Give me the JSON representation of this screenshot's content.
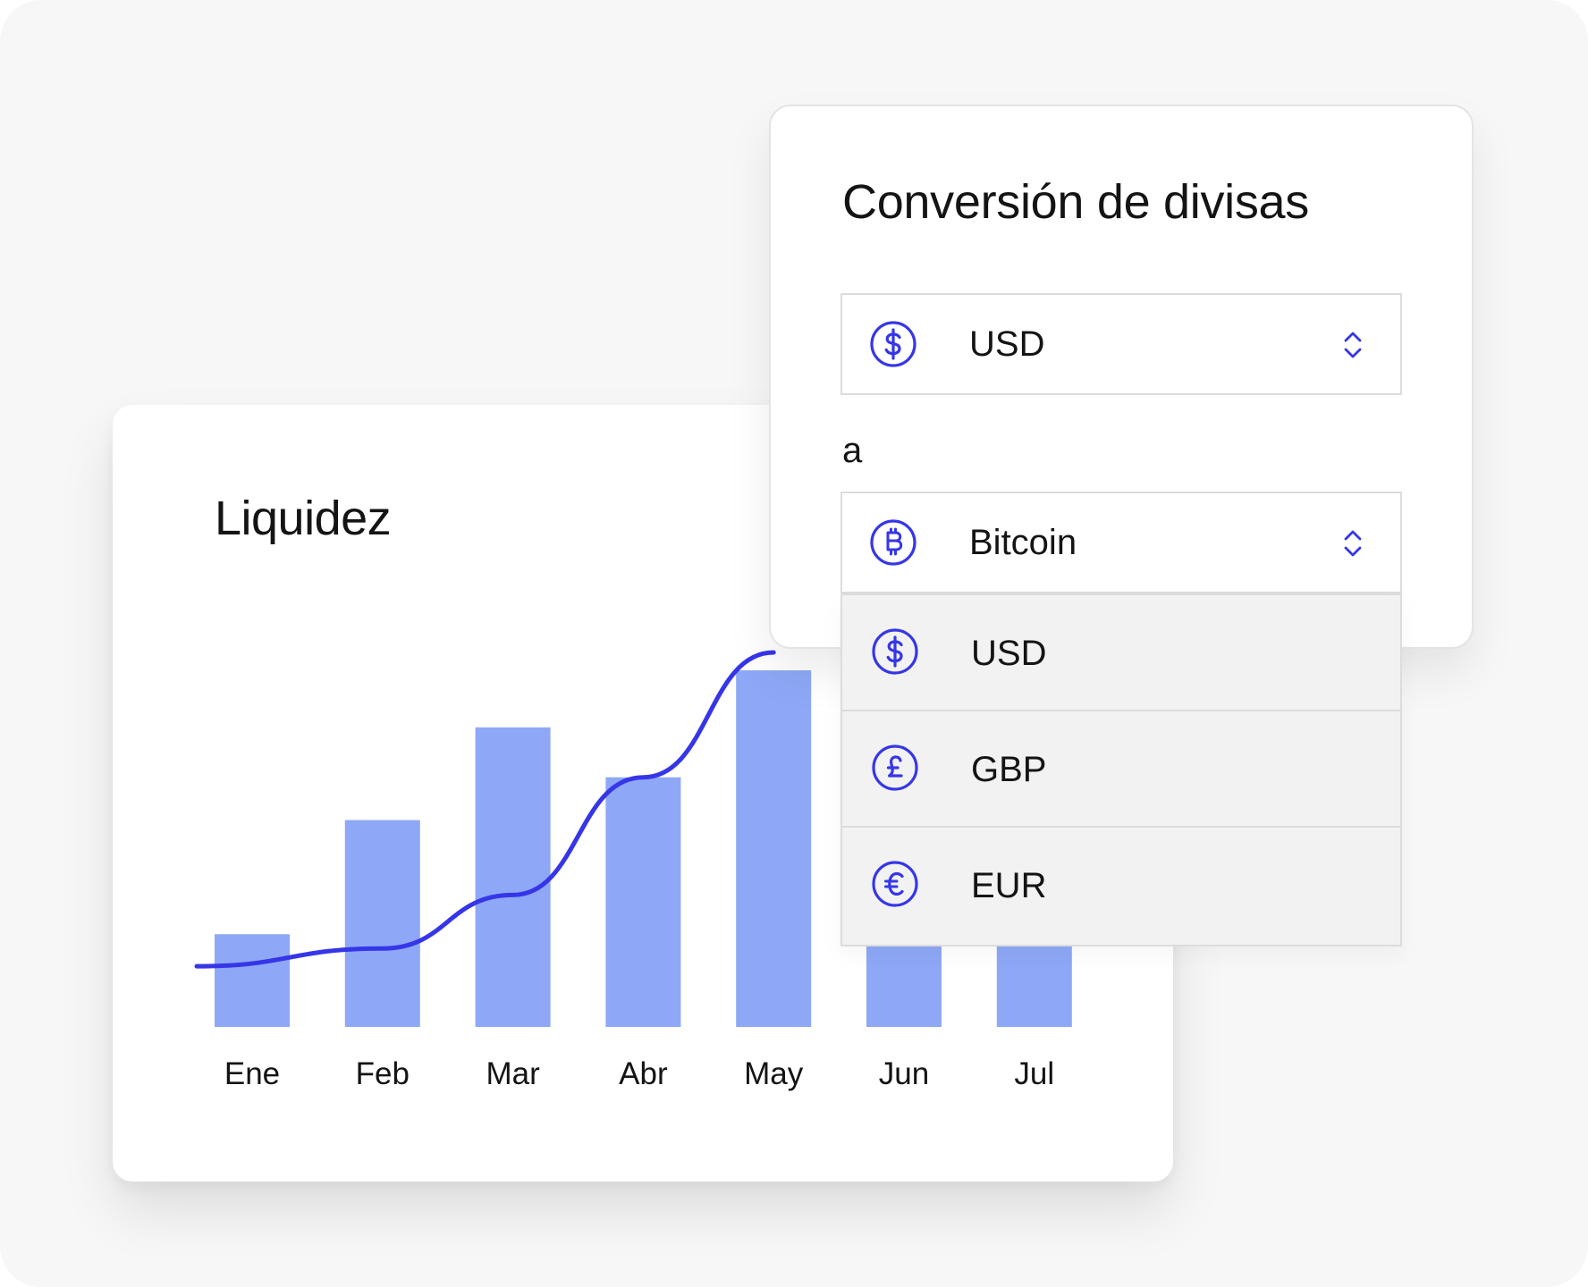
{
  "chart": {
    "title": "Liquidez"
  },
  "chart_data": {
    "type": "bar",
    "title": "Liquidez",
    "xlabel": "",
    "ylabel": "",
    "categories": [
      "Ene",
      "Feb",
      "Mar",
      "Abr",
      "May",
      "Jun",
      "Jul"
    ],
    "values": [
      0.26,
      0.58,
      0.84,
      0.7,
      1.0,
      0.26,
      0.26
    ],
    "ylim": [
      0,
      1
    ],
    "grid": false,
    "colors": {
      "bar": "#8ea8f7",
      "line": "#3636e8"
    },
    "trend_line": {
      "type": "line",
      "x": [
        "Ene",
        "Feb",
        "Mar",
        "Abr",
        "May"
      ],
      "values": [
        0.17,
        0.22,
        0.37,
        0.7,
        1.05
      ],
      "note_hidden": "line continues beneath the conversion card"
    }
  },
  "conversion": {
    "title": "Conversión de divisas",
    "to_label": "a",
    "from": {
      "value": "USD",
      "icon": "dollar-icon"
    },
    "to": {
      "value": "Bitcoin",
      "icon": "bitcoin-icon"
    },
    "options": [
      {
        "value": "USD",
        "icon": "dollar-icon"
      },
      {
        "value": "GBP",
        "icon": "pound-icon"
      },
      {
        "value": "EUR",
        "icon": "euro-icon"
      }
    ]
  },
  "colors": {
    "accent": "#3636e8",
    "bar": "#8ea8f7",
    "background": "#f7f7f7",
    "dropdown_bg": "#f2f2f2"
  }
}
